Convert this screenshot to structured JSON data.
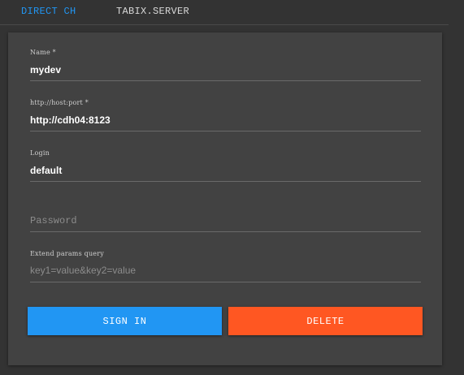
{
  "tabs": [
    {
      "label": "DIRECT CH",
      "active": true
    },
    {
      "label": "TABIX.SERVER",
      "active": false
    }
  ],
  "form": {
    "name": {
      "label": "Name *",
      "value": "mydev"
    },
    "host": {
      "label": "http://host:port *",
      "value": "http://cdh04:8123"
    },
    "login": {
      "label": "Login",
      "value": "default"
    },
    "password": {
      "placeholder": "Password",
      "value": ""
    },
    "params": {
      "label": "Extend params query",
      "placeholder": "key1=value&key2=value"
    }
  },
  "buttons": {
    "sign_in": "SIGN IN",
    "delete": "DELETE"
  },
  "colors": {
    "background": "#333333",
    "card": "#424242",
    "accent_blue": "#2196f3",
    "accent_orange": "#ff5722"
  }
}
